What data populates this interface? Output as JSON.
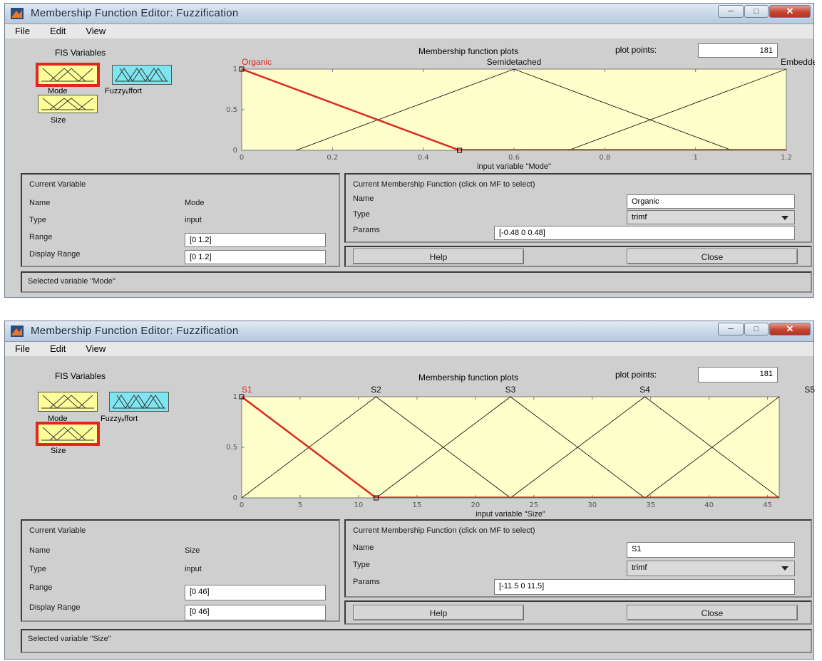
{
  "windows": [
    {
      "title": "Membership Function Editor: Fuzzification",
      "menu": [
        "File",
        "Edit",
        "View"
      ],
      "fis_variables_label": "FIS Variables",
      "variables": [
        {
          "name": "Mode",
          "selected": true
        },
        {
          "name": "Fuzzy_Effort",
          "display_name": "Fuzzyₑffort",
          "selected": false
        },
        {
          "name": "Size",
          "selected": false
        }
      ],
      "plot_title": "Membership function plots",
      "plot_points_label": "plot points:",
      "plot_points_value": "181",
      "xlabel": "input variable \"Mode\"",
      "current_variable": {
        "header": "Current Variable",
        "name_label": "Name",
        "name_value": "Mode",
        "type_label": "Type",
        "type_value": "input",
        "range_label": "Range",
        "range_value": "[0 1.2]",
        "display_range_label": "Display Range",
        "display_range_value": "[0 1.2]"
      },
      "current_mf": {
        "header": "Current Membership Function (click on MF to select)",
        "name_label": "Name",
        "name_value": "Organic",
        "type_label": "Type",
        "type_value": "trimf",
        "params_label": "Params",
        "params_value": "[-0.48 0 0.48]"
      },
      "help_label": "Help",
      "close_label": "Close",
      "status": "Selected variable \"Mode\"",
      "chart_data": {
        "type": "line",
        "xlim": [
          0,
          1.2
        ],
        "ylim": [
          0,
          1
        ],
        "xticks": [
          "0",
          "0.2",
          "0.4",
          "0.6",
          "0.8",
          "1",
          "1.2"
        ],
        "yticks": [
          "0",
          "0.5",
          "1"
        ],
        "xlabel": "input variable \"Mode\"",
        "selected_color": "#e0261f",
        "line_color": "#000000",
        "background": "#ffffcc",
        "series": [
          {
            "name": "Organic",
            "params": [
              -0.48,
              0,
              0.48
            ],
            "selected": true
          },
          {
            "name": "Semidetached",
            "params": [
              0.12,
              0.6,
              1.08
            ],
            "selected": false
          },
          {
            "name": "Embedded",
            "params": [
              0.72,
              1.2,
              1.68
            ],
            "selected": false
          }
        ]
      }
    },
    {
      "title": "Membership Function Editor: Fuzzification",
      "menu": [
        "File",
        "Edit",
        "View"
      ],
      "fis_variables_label": "FIS Variables",
      "variables": [
        {
          "name": "Mode",
          "selected": false
        },
        {
          "name": "Fuzzy_Effort",
          "display_name": "Fuzzyₑffort",
          "selected": false
        },
        {
          "name": "Size",
          "selected": true
        }
      ],
      "plot_title": "Membership function plots",
      "plot_points_label": "plot points:",
      "plot_points_value": "181",
      "xlabel": "input variable \"Size\"",
      "current_variable": {
        "header": "Current Variable",
        "name_label": "Name",
        "name_value": "Size",
        "type_label": "Type",
        "type_value": "input",
        "range_label": "Range",
        "range_value": "[0 46]",
        "display_range_label": "Display Range",
        "display_range_value": "[0 46]"
      },
      "current_mf": {
        "header": "Current Membership Function (click on MF to select)",
        "name_label": "Name",
        "name_value": "S1",
        "type_label": "Type",
        "type_value": "trimf",
        "params_label": "Params",
        "params_value": "[-11.5 0 11.5]"
      },
      "help_label": "Help",
      "close_label": "Close",
      "status": "Selected variable \"Size\"",
      "chart_data": {
        "type": "line",
        "xlim": [
          0,
          46
        ],
        "ylim": [
          0,
          1
        ],
        "xticks": [
          "0",
          "5",
          "10",
          "15",
          "20",
          "25",
          "30",
          "35",
          "40",
          "45"
        ],
        "yticks": [
          "0",
          "0.5",
          "1"
        ],
        "xlabel": "input variable \"Size\"",
        "selected_color": "#e0261f",
        "line_color": "#000000",
        "background": "#ffffcc",
        "series": [
          {
            "name": "S1",
            "params": [
              -11.5,
              0,
              11.5
            ],
            "selected": true
          },
          {
            "name": "S2",
            "params": [
              0,
              11.5,
              23
            ],
            "selected": false
          },
          {
            "name": "S3",
            "params": [
              11.5,
              23,
              34.5
            ],
            "selected": false
          },
          {
            "name": "S4",
            "params": [
              23,
              34.5,
              46
            ],
            "selected": false
          },
          {
            "name": "S5",
            "params": [
              34.5,
              46,
              57.5
            ],
            "selected": false
          }
        ]
      }
    }
  ],
  "colors": {
    "selected_outline": "#e0261f",
    "input_box": "#ffff99",
    "output_box": "#7fe5f0",
    "titlebar": "#c5d4e6"
  }
}
